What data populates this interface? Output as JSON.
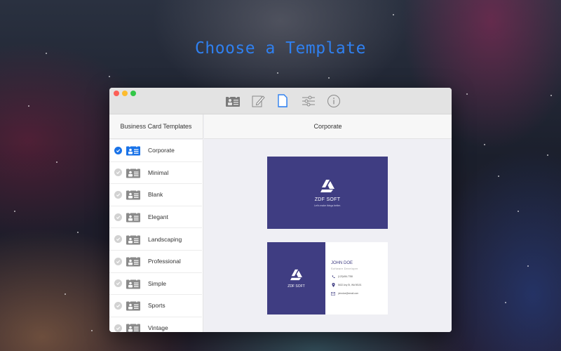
{
  "headline": "Choose a Template",
  "window": {
    "toolbar": [
      {
        "icon": "contact-card-icon",
        "label": "Card",
        "active": false
      },
      {
        "icon": "edit-icon",
        "label": "Edit",
        "active": false
      },
      {
        "icon": "template-document-icon",
        "label": "Templates",
        "active": true
      },
      {
        "icon": "sliders-icon",
        "label": "Settings",
        "active": false
      },
      {
        "icon": "info-icon",
        "label": "Info",
        "active": false
      }
    ],
    "sidebar": {
      "title": "Business Card Templates",
      "items": [
        {
          "label": "Corporate",
          "selected": true
        },
        {
          "label": "Minimal",
          "selected": false
        },
        {
          "label": "Blank",
          "selected": false
        },
        {
          "label": "Elegant",
          "selected": false
        },
        {
          "label": "Landscaping",
          "selected": false
        },
        {
          "label": "Professional",
          "selected": false
        },
        {
          "label": "Simple",
          "selected": false
        },
        {
          "label": "Sports",
          "selected": false
        },
        {
          "label": "Vintage",
          "selected": false
        }
      ]
    },
    "main": {
      "title": "Corporate",
      "front": {
        "company": "ZDF SOFT",
        "tagline": "Let's make things better."
      },
      "back": {
        "company": "ZDF SOFT",
        "name": "JOHN DOE",
        "job_title": "Software Developer",
        "phone": "(123)456-7788",
        "address": "5432 Any St, WA 98101",
        "email": "johndoe@email.com"
      }
    }
  },
  "colors": {
    "accent": "#2f80f0",
    "card_primary": "#3f3d82",
    "selected_check": "#1a73e8"
  }
}
